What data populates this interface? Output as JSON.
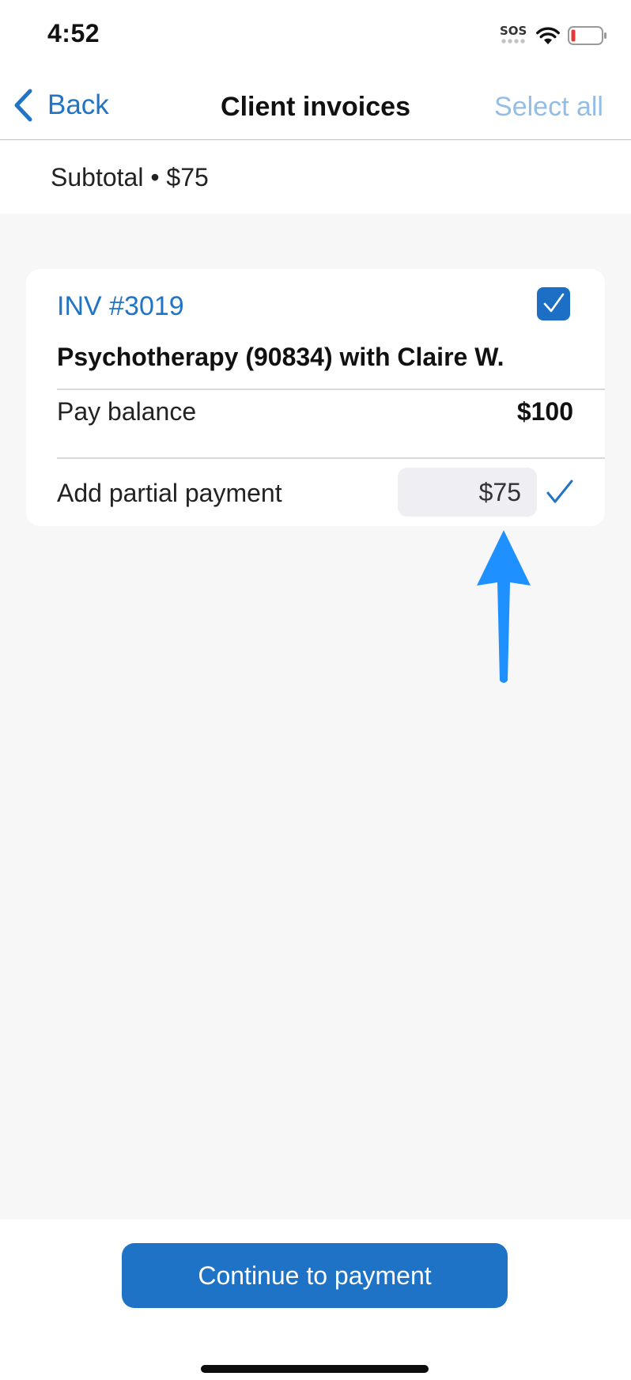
{
  "status_bar": {
    "time": "4:52",
    "sos_label": "SOS",
    "icons": [
      "wifi-icon",
      "battery-low-icon"
    ],
    "battery_color": "#e53935"
  },
  "nav": {
    "back_label": "Back",
    "title": "Client invoices",
    "select_all_label": "Select all"
  },
  "subtotal": {
    "text": "Subtotal • $75"
  },
  "invoice": {
    "number": "INV #3019",
    "selected": true,
    "service": "Psychotherapy (90834) with Claire W.",
    "pay_balance_label": "Pay balance",
    "pay_balance_value": "$100",
    "partial_payment_label": "Add partial payment",
    "partial_payment_value": "$75"
  },
  "footer": {
    "continue_label": "Continue to payment"
  },
  "colors": {
    "accent": "#2274c5",
    "button": "#1f73c7",
    "select_all_disabled": "#94bde6",
    "annotation_arrow": "#1e90ff",
    "background": "#f7f7f7"
  }
}
